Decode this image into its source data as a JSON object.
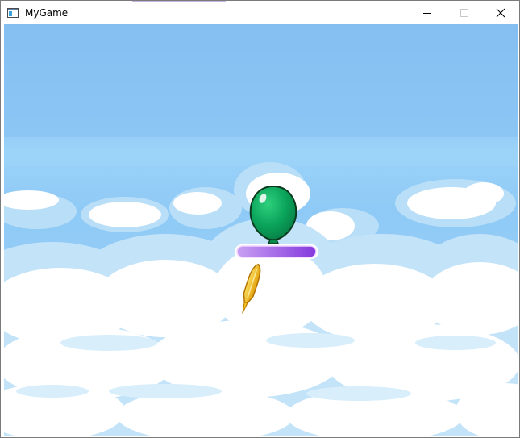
{
  "window": {
    "title": "MyGame",
    "icon": "app-window-icon",
    "controls": [
      "minimize-icon",
      "maximize-icon",
      "close-icon"
    ]
  },
  "game": {
    "scene": "sky-with-clouds",
    "colors": {
      "sky_top": "#86c0f2",
      "sky_band": "#93cdf6",
      "cloud_white": "#ffffff",
      "cloud_light": "#d9eefb",
      "cloud_shadow": "#b5dcf6",
      "balloon": "#0aa35a",
      "balloon_outline": "#0b3b1e",
      "platform_left": "#c79cf2",
      "platform_right": "#8a3de0",
      "dart": "#f4c21a"
    },
    "sprites": [
      "balloon",
      "platform",
      "dart"
    ]
  }
}
